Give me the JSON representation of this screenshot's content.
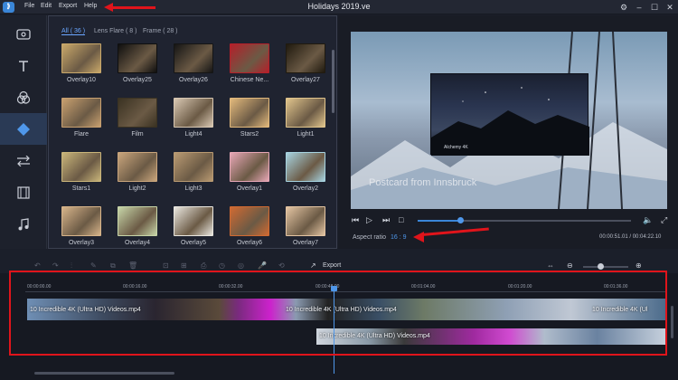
{
  "window": {
    "title": "Holidays 2019.ve",
    "logo_text": "⟫"
  },
  "menu": [
    "File",
    "Edit",
    "Export",
    "Help"
  ],
  "library": {
    "tabs": [
      "All ( 36 )",
      "Lens Flare ( 8 )",
      "Frame ( 28 )"
    ],
    "items": [
      {
        "label": "Overlay10",
        "color": "#c9a86a"
      },
      {
        "label": "Overlay25",
        "color": "#0f0f0f"
      },
      {
        "label": "Overlay26",
        "color": "#151515"
      },
      {
        "label": "Chinese Ne...",
        "color": "#b4202a"
      },
      {
        "label": "Overlay27",
        "color": "#201a0f"
      },
      {
        "label": "Flare",
        "color": "#c8a070"
      },
      {
        "label": "Film",
        "color": "#3a3222"
      },
      {
        "label": "Light4",
        "color": "#d8c7b2"
      },
      {
        "label": "Stars2",
        "color": "#e2b97c"
      },
      {
        "label": "Light1",
        "color": "#e0c48c"
      },
      {
        "label": "Stars1",
        "color": "#c9b57a"
      },
      {
        "label": "Light2",
        "color": "#c9a57c"
      },
      {
        "label": "Light3",
        "color": "#b99a72"
      },
      {
        "label": "Overlay1",
        "color": "#e7a7b6"
      },
      {
        "label": "Overlay2",
        "color": "#a7d3e0"
      },
      {
        "label": "Overlay3",
        "color": "#d7b48a"
      },
      {
        "label": "Overlay4",
        "color": "#c7d5a8"
      },
      {
        "label": "Overlay5",
        "color": "#e9e6df"
      },
      {
        "label": "Overlay6",
        "color": "#d06a32"
      },
      {
        "label": "Overlay7",
        "color": "#e3c4a2"
      }
    ]
  },
  "preview": {
    "inset_label": "Alchemy 4K",
    "caption": "Postcard from Innsbruck",
    "aspect_label": "Aspect ratio",
    "aspect_value": "16 : 9",
    "timecode": "00:00:51.01 / 00:04:22.10",
    "progress": 0.2
  },
  "toolbar": {
    "export_label": "Export"
  },
  "timeline": {
    "ruler": [
      "00:00:00.00",
      "00:00:16.00",
      "00:00:32.00",
      "00:00:48.00",
      "00:01:04.00",
      "00:01:20.00",
      "00:01:36.00"
    ],
    "track1_labels": [
      "10 Incredible 4K (Ultra HD) Videos.mp4",
      "10 Incredible 4K (Ultra HD) Videos.mp4",
      "10 Incredible 4K (Ul"
    ],
    "track2_label": "10 Incredible 4K (Ultra HD) Videos.mp4"
  },
  "colors": {
    "accent": "#3a86d8",
    "annotation": "#e0141b"
  }
}
